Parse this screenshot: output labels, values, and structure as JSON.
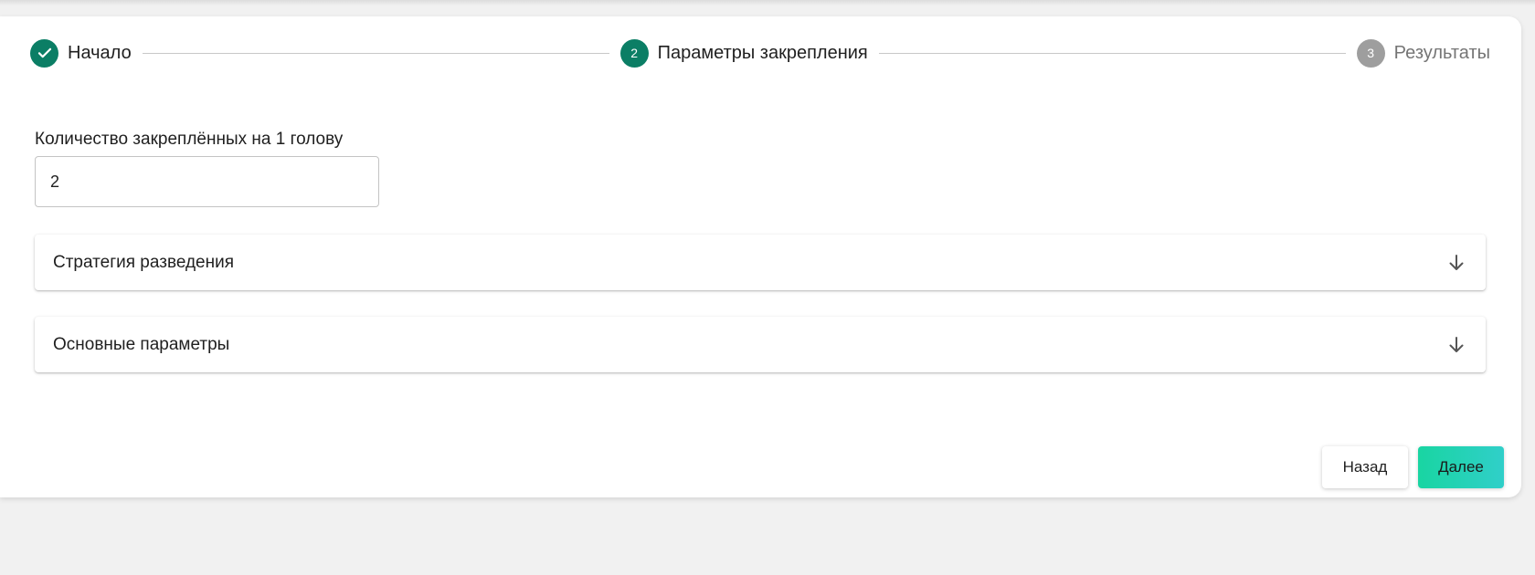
{
  "stepper": {
    "steps": [
      {
        "number": "",
        "label": "Начало",
        "state": "done",
        "icon": "check-icon"
      },
      {
        "number": "2",
        "label": "Параметры закрепления",
        "state": "active"
      },
      {
        "number": "3",
        "label": "Результаты",
        "state": "inactive"
      }
    ]
  },
  "form": {
    "count_label": "Количество закреплённых на 1 голову",
    "count_value": "2"
  },
  "accordions": [
    {
      "title": "Стратегия разведения",
      "icon": "arrow-down-icon"
    },
    {
      "title": "Основные параметры",
      "icon": "arrow-down-icon"
    }
  ],
  "actions": {
    "back_label": "Назад",
    "next_label": "Далее"
  },
  "colors": {
    "accent": "#0b7e65",
    "inactive_step": "#9e9e9e",
    "next_gradient_start": "#19d5a2",
    "next_gradient_end": "#30cfc9"
  }
}
